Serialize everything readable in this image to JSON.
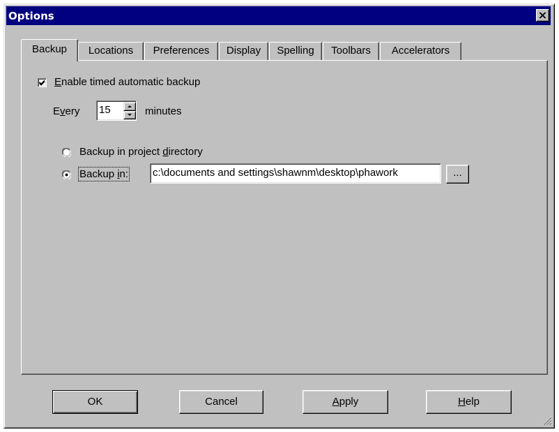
{
  "window": {
    "title": "Options"
  },
  "tabs": [
    {
      "label": "Backup",
      "active": true
    },
    {
      "label": "Locations",
      "active": false
    },
    {
      "label": "Preferences",
      "active": false
    },
    {
      "label": "Display",
      "active": false
    },
    {
      "label": "Spelling",
      "active": false
    },
    {
      "label": "Toolbars",
      "active": false
    },
    {
      "label": "Accelerators",
      "active": false
    }
  ],
  "backup": {
    "enable_checkbox": {
      "label_accel": "E",
      "label_rest": "nable timed automatic backup",
      "checked": true
    },
    "every": {
      "label_pre": "E",
      "label_accel": "v",
      "label_post": "ery",
      "value": "15",
      "unit_label": "minutes"
    },
    "radio_project": {
      "label_pre": "Backup in project ",
      "label_accel": "d",
      "label_post": "irectory",
      "selected": false
    },
    "radio_custom": {
      "label_pre": "Backup ",
      "label_accel": "i",
      "label_post": "n:",
      "selected": true,
      "path_value": "c:\\documents and settings\\shawnm\\desktop\\phawork",
      "browse_label": "..."
    }
  },
  "buttons": {
    "ok": "OK",
    "cancel": "Cancel",
    "apply_accel": "A",
    "apply_rest": "pply",
    "help_accel": "H",
    "help_rest": "elp"
  },
  "colors": {
    "titlebar": "#000080",
    "face": "#c0c0c0"
  }
}
